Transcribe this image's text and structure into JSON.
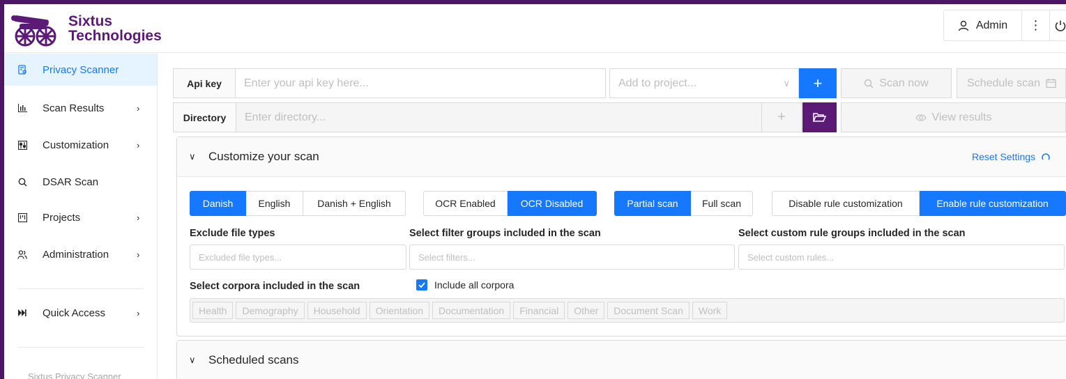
{
  "brand": {
    "name_line1": "Sixtus",
    "name_line2": "Technologies",
    "color": "#5c1a77"
  },
  "header": {
    "user_label": "Admin",
    "more_icon": "⋮"
  },
  "sidebar": {
    "items": [
      {
        "label": "Privacy Scanner",
        "icon": "scan-doc-icon",
        "active": true
      },
      {
        "label": "Scan Results",
        "icon": "bar-chart-icon",
        "has_submenu": true
      },
      {
        "label": "Customization",
        "icon": "sliders-icon",
        "has_submenu": true
      },
      {
        "label": "DSAR Scan",
        "icon": "search-icon"
      },
      {
        "label": "Projects",
        "icon": "project-icon",
        "has_submenu": true
      },
      {
        "label": "Administration",
        "icon": "users-icon",
        "has_submenu": true
      },
      {
        "label": "Quick Access",
        "icon": "fast-forward-icon",
        "has_submenu": true
      }
    ],
    "footer": "Sixtus Privacy Scanner"
  },
  "toolbar": {
    "api_key_label": "Api key",
    "api_key_placeholder": "Enter your api key here...",
    "project_placeholder": "Add to project...",
    "add_project_label": "+",
    "scan_now_label": "Scan now",
    "schedule_scan_label": "Schedule scan",
    "directory_label": "Directory",
    "directory_placeholder": "Enter directory...",
    "add_dir_label": "+",
    "view_results_label": "View results"
  },
  "customize": {
    "title": "Customize your scan",
    "reset_label": "Reset Settings",
    "language": {
      "options": [
        "Danish",
        "English",
        "Danish + English"
      ],
      "selected": "Danish"
    },
    "ocr": {
      "options": [
        "OCR Enabled",
        "OCR Disabled"
      ],
      "selected": "OCR Disabled"
    },
    "scan_type": {
      "options": [
        "Partial scan",
        "Full scan"
      ],
      "selected": "Partial scan"
    },
    "rule_customization": {
      "options": [
        "Disable rule customization",
        "Enable rule customization"
      ],
      "selected": "Enable rule customization"
    },
    "exclude_label": "Exclude file types",
    "exclude_placeholder": "Excluded file types...",
    "filters_label": "Select filter groups included in the scan",
    "filters_placeholder": "Select filters...",
    "custom_rules_label": "Select custom rule groups included in the scan",
    "custom_rules_placeholder": "Select custom rules...",
    "corpora_label": "Select corpora included in the scan",
    "include_all_label": "Include all corpora",
    "include_all_checked": true,
    "corpora": [
      "Health",
      "Demography",
      "Household",
      "Orientation",
      "Documentation",
      "Financial",
      "Other",
      "Document Scan",
      "Work"
    ]
  },
  "scheduled": {
    "title": "Scheduled scans"
  },
  "colors": {
    "primary": "#1677ff",
    "accent": "#5c1a77",
    "frame": "#4a1760"
  }
}
